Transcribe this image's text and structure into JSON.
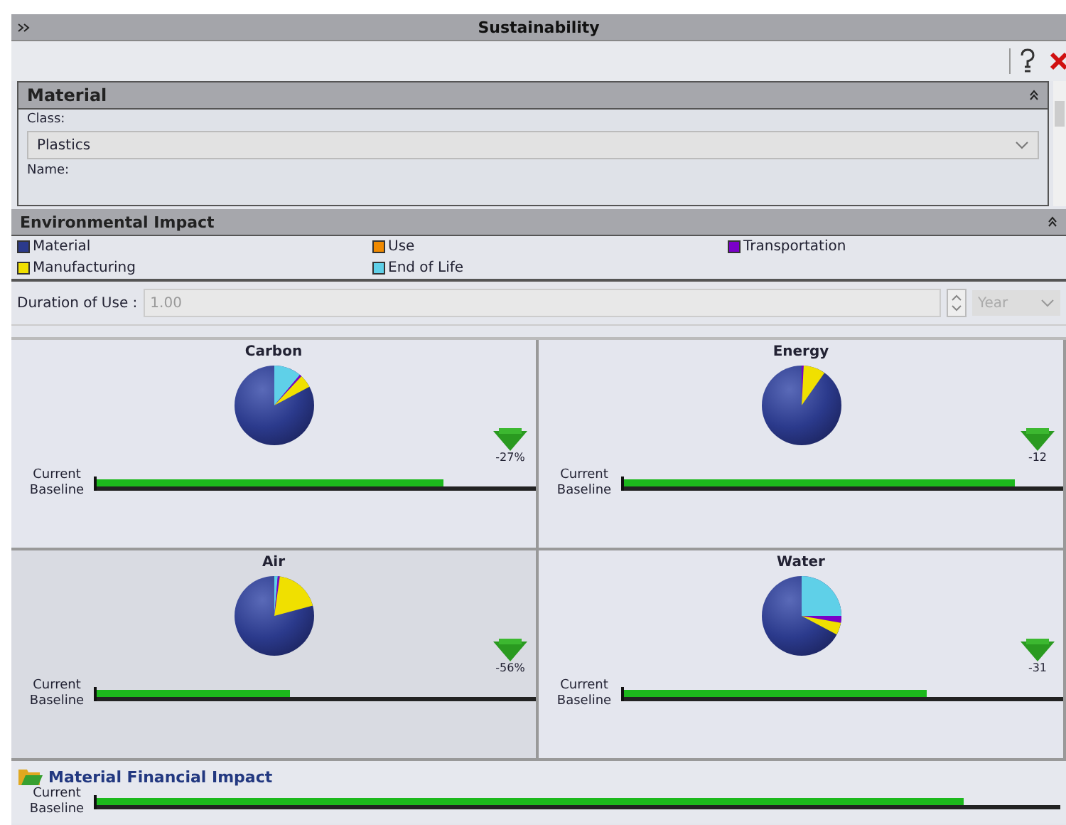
{
  "window": {
    "title": "Sustainability"
  },
  "material": {
    "title": "Material",
    "class_label": "Class:",
    "class_value": "Plastics",
    "name_label": "Name:"
  },
  "environmental_impact": {
    "title": "Environmental Impact",
    "legend": [
      {
        "label": "Material",
        "color": "#2b3a8c"
      },
      {
        "label": "Use",
        "color": "#f08a00"
      },
      {
        "label": "Transportation",
        "color": "#7a00c8"
      },
      {
        "label": "Manufacturing",
        "color": "#f0e000"
      },
      {
        "label": "End of Life",
        "color": "#5fd0e8"
      }
    ],
    "duration_label": "Duration of Use :",
    "duration_value": "1.00",
    "unit": "Year",
    "panels": [
      {
        "title": "Carbon",
        "change": "-27%",
        "current_label": "Current",
        "baseline_label": "Baseline",
        "level": 0.79
      },
      {
        "title": "Energy",
        "change": "-12",
        "current_label": "Current",
        "baseline_label": "Baseline",
        "level": 0.89
      },
      {
        "title": "Air",
        "change": "-56%",
        "current_label": "Current",
        "baseline_label": "Baseline",
        "level": 0.44
      },
      {
        "title": "Water",
        "change": "-31",
        "current_label": "Current",
        "baseline_label": "Baseline",
        "level": 0.69
      }
    ]
  },
  "financial": {
    "title": "Material Financial Impact",
    "current_label": "Current",
    "baseline_label": "Baseline",
    "level": 0.9
  }
}
